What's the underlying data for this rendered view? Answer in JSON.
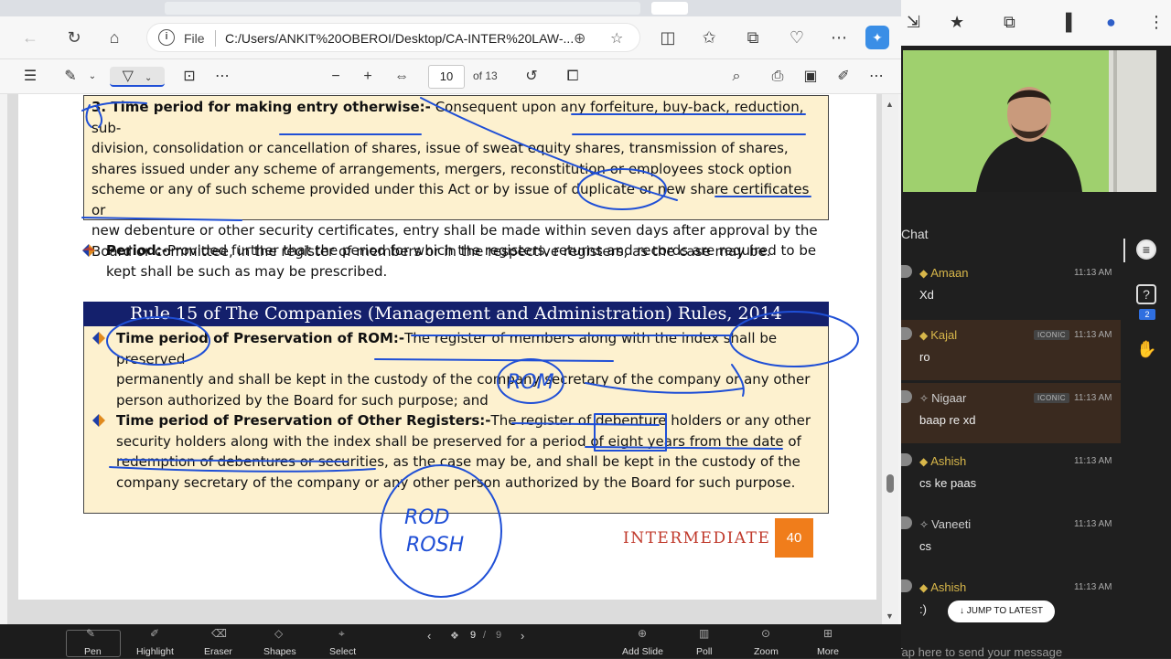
{
  "browser": {
    "url": {
      "scheme_label": "File",
      "path": "C:/Users/ANKIT%20OBEROI/Desktop/CA-INTER%20LAW-..."
    }
  },
  "pdf": {
    "current_page": "10",
    "total_pages": "of 13"
  },
  "document": {
    "section3": {
      "heading": "3. Time period for making entry otherwise:-",
      "lines": [
        "Consequent upon any forfeiture, buy-back, reduction, sub-",
        "division, consolidation or cancellation of shares, issue of sweat equity shares, transmission of shares,",
        "shares issued under any scheme of arrangements, mergers, reconstitution or employees stock option",
        "scheme or any of such scheme provided under this Act or by issue of duplicate or new share certificates or",
        "new debenture or other security certificates, entry shall be made within seven days after approval by the",
        "Board or committee, in the register of members or in the respective registers, as the case may be."
      ]
    },
    "period": {
      "label": "Period:-",
      "lines": [
        "Provided further that the period for which the registers, returns and records are required to be",
        "kept shall be such as may be prescribed."
      ]
    },
    "rule": {
      "title": "Rule 15 of The Companies (Management and Administration) Rules, 2014",
      "rom": {
        "label": "Time period of Preservation of ROM:-",
        "lines": [
          "The register of members along with the index shall be preserved",
          "permanently and shall be kept in the custody of the company secretary of the company or any other",
          "person authorized by the Board for such purpose; and"
        ]
      },
      "other": {
        "label": "Time period of Preservation of Other Registers:-",
        "lines": [
          "The register of debenture holders or any other",
          "security holders along with the index shall be preserved for a period of eight years from the date of",
          "redemption of debentures or securities, as the case may be, and shall be kept in the custody of the",
          "company secretary of the company or any other person authorized by the Board for such purpose."
        ]
      }
    },
    "footer": {
      "label": "INTERMEDIATE",
      "page": "40"
    },
    "handwriting": {
      "rom": "ROM",
      "rod1": "ROD",
      "rod2": "ROSH"
    }
  },
  "chat": {
    "title": "Chat",
    "messages": [
      {
        "name": "Amaan",
        "time": "11:13 AM",
        "text": "Xd",
        "badge": ""
      },
      {
        "name": "Kajal",
        "time": "11:13 AM",
        "text": "ro",
        "badge": "ICONIC"
      },
      {
        "name": "Nigaar",
        "time": "11:13 AM",
        "text": "baap re xd",
        "badge": "ICONIC"
      },
      {
        "name": "Ashish",
        "time": "11:13 AM",
        "text": "cs ke paas",
        "badge": ""
      },
      {
        "name": "Vaneeti",
        "time": "11:13 AM",
        "text": "cs",
        "badge": ""
      },
      {
        "name": "Ashish",
        "time": "11:13 AM",
        "text": ":)",
        "badge": ""
      }
    ],
    "jump_label": "JUMP TO LATEST",
    "input_placeholder": "Tap here to send your message",
    "question_count": "2"
  },
  "bottom_tools": {
    "pen": "Pen",
    "highlight": "Highlight",
    "eraser": "Eraser",
    "shapes": "Shapes",
    "select": "Select",
    "slide_counter": "9",
    "slide_total": "9",
    "add_slide": "Add Slide",
    "poll": "Poll",
    "zoom": "Zoom",
    "more": "More"
  },
  "colors": {
    "ink": "#1f4fd6",
    "box_fill": "#fdf1cf",
    "rule_bar": "#14206c",
    "footer_accent": "#f07d1b",
    "footer_text": "#c0392b"
  }
}
